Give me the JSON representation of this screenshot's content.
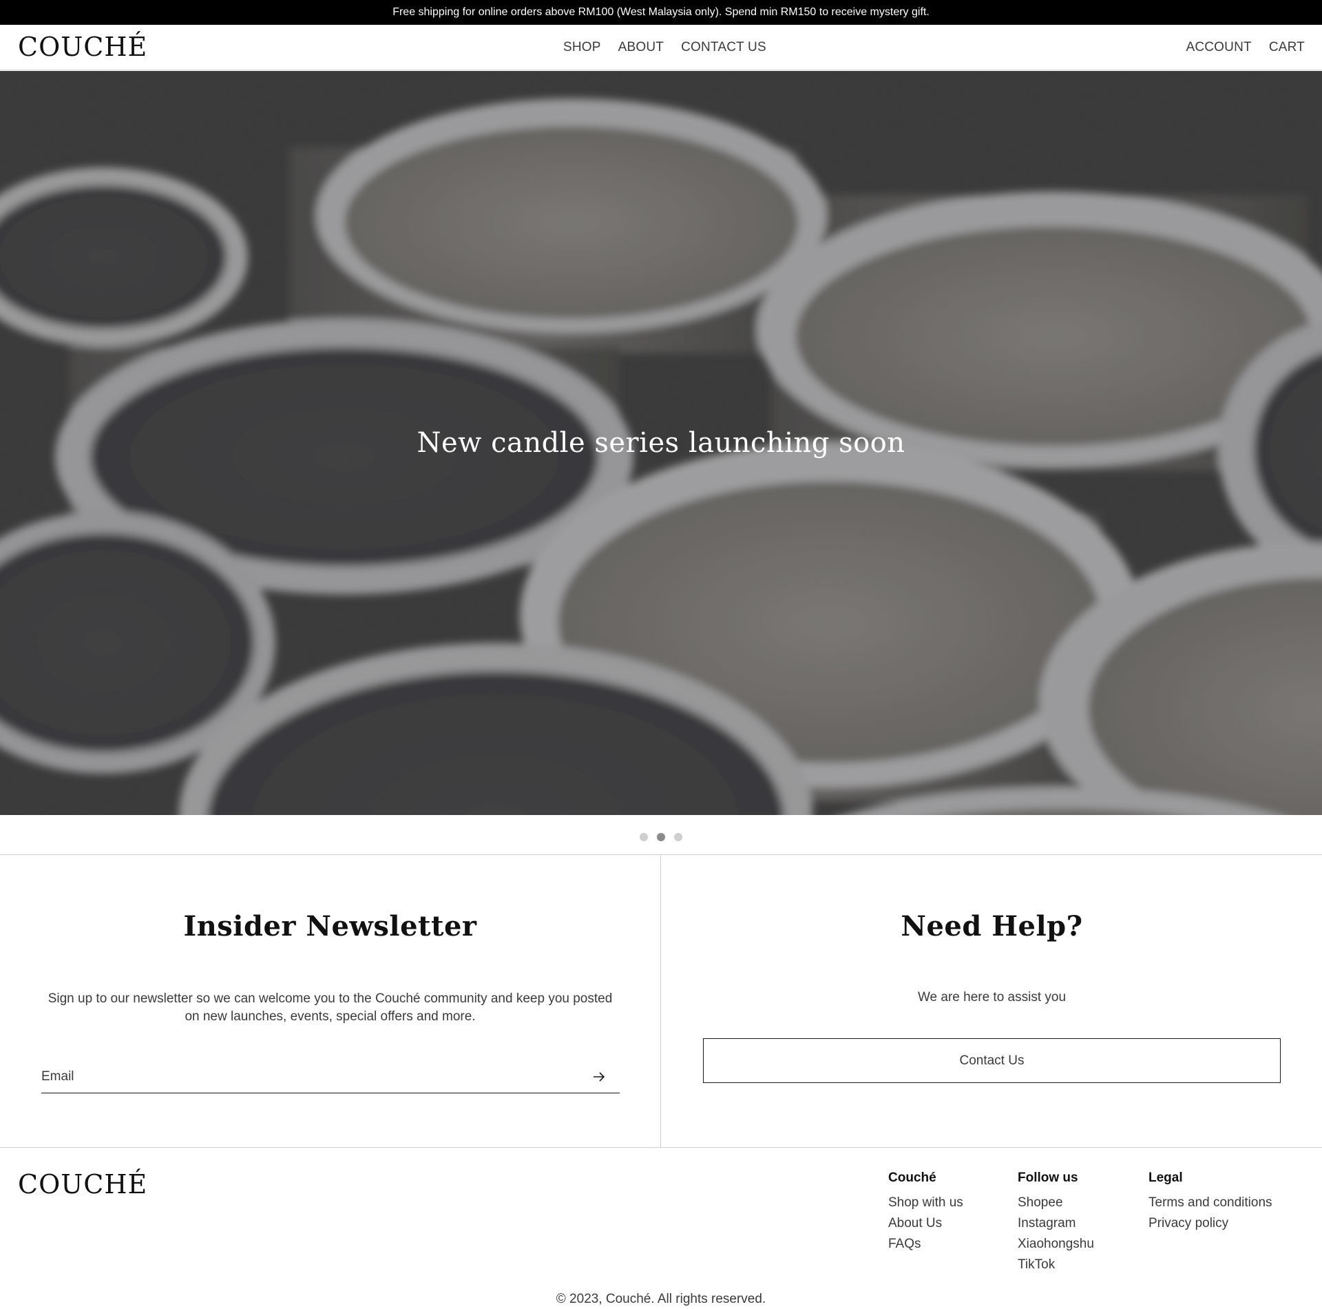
{
  "announcement": {
    "text": "Free shipping for online orders above RM100 (West Malaysia only). Spend min RM150 to receive mystery gift."
  },
  "header": {
    "logo": "COUCHÉ",
    "nav": [
      "SHOP",
      "ABOUT",
      "CONTACT US"
    ],
    "account": "ACCOUNT",
    "cart": "CART"
  },
  "hero": {
    "title": "New candle series launching soon",
    "image": "close-up-candle-tins-photo",
    "slides": 3,
    "active_slide": 2
  },
  "newsletter": {
    "title": "Insider Newsletter",
    "text": "Sign up to our newsletter so we can welcome you to the Couché community and keep you posted on new launches, events, special offers and more.",
    "email_placeholder": "Email",
    "submit_icon": "arrow-right-icon"
  },
  "help": {
    "title": "Need Help?",
    "text": "We are here to assist you",
    "button": "Contact Us"
  },
  "footer": {
    "logo": "COUCHÉ",
    "columns": [
      {
        "heading": "Couché",
        "links": [
          "Shop with us",
          "About Us",
          "FAQs"
        ]
      },
      {
        "heading": "Follow us",
        "links": [
          "Shopee",
          "Instagram",
          "Xiaohongshu",
          "TikTok"
        ]
      },
      {
        "heading": "Legal",
        "links": [
          "Terms and conditions",
          "Privacy policy"
        ]
      }
    ],
    "copyright": "© 2023, Couché. All rights reserved."
  },
  "colors": {
    "announcement_bg": "#000000",
    "text": "#1a1a1a",
    "border": "#cfcfcf",
    "dot_active": "#8a8a8a",
    "dot_inactive": "#cfcfcf"
  }
}
